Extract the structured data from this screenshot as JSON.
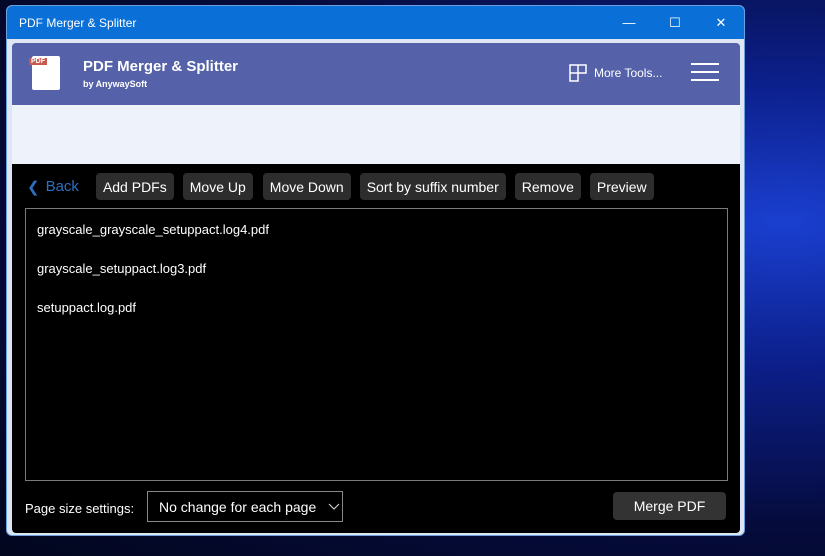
{
  "window": {
    "title": "PDF Merger & Splitter"
  },
  "header": {
    "title": "PDF Merger & Splitter",
    "subtitle": "by AnywaySoft",
    "logo_text": "PDF",
    "more_tools": "More Tools..."
  },
  "toolbar": {
    "back": "Back",
    "buttons": [
      "Add PDFs",
      "Move Up",
      "Move Down",
      "Sort by suffix number",
      "Remove",
      "Preview"
    ]
  },
  "files": [
    "grayscale_grayscale_setuppact.log4.pdf",
    "grayscale_setuppact.log3.pdf",
    "setuppact.log.pdf"
  ],
  "footer": {
    "page_size_label": "Page size settings:",
    "page_size_value": "No change for each page",
    "merge": "Merge PDF"
  }
}
